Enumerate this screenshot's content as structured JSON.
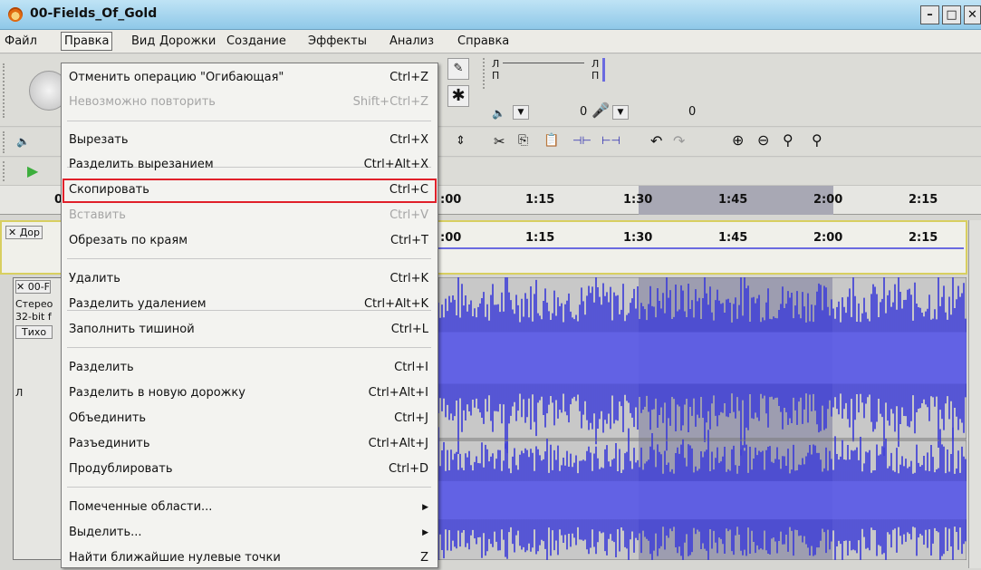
{
  "window": {
    "title": "00-Fields_Of_Gold",
    "minimize": "–",
    "maximize": "□",
    "close": "✕"
  },
  "menubar": {
    "items": [
      "Файл",
      "Правка",
      "Вид",
      "Дорожки",
      "Создание",
      "Эффекты",
      "Анализ",
      "Справка"
    ]
  },
  "ruler": {
    "ticks": [
      ":00",
      "1:15",
      "1:30",
      "1:45",
      "2:00",
      "2:15"
    ],
    "left_tick": "0"
  },
  "timeline": {
    "ticks": [
      ":00",
      "1:15",
      "1:30",
      "1:45",
      "2:00",
      "2:15"
    ]
  },
  "meters": {
    "l1": "Л",
    "r1": "П",
    "l2": "Л",
    "r2": "П",
    "val1": "0",
    "val2": "0"
  },
  "left_panel": {
    "track1": "✕ Дор",
    "track2": "✕ 00-F",
    "stereo": "Стерео",
    "bits": "32-bit f",
    "mute": "Тихо",
    "pan": "Л"
  },
  "edit_menu": {
    "items": [
      {
        "label": "Отменить операцию \"Огибающая\"",
        "shortcut": "Ctrl+Z",
        "enabled": true
      },
      {
        "label": "Невозможно повторить",
        "shortcut": "Shift+Ctrl+Z",
        "enabled": false
      },
      {
        "label": "Вырезать",
        "shortcut": "Ctrl+X",
        "enabled": true
      },
      {
        "label": "Разделить вырезанием",
        "shortcut": "Ctrl+Alt+X",
        "enabled": true
      },
      {
        "label": "Скопировать",
        "shortcut": "Ctrl+C",
        "enabled": true
      },
      {
        "label": "Вставить",
        "shortcut": "Ctrl+V",
        "enabled": false
      },
      {
        "label": "Обрезать по краям",
        "shortcut": "Ctrl+T",
        "enabled": true
      },
      {
        "label": "Удалить",
        "shortcut": "Ctrl+K",
        "enabled": true
      },
      {
        "label": "Разделить удалением",
        "shortcut": "Ctrl+Alt+K",
        "enabled": true
      },
      {
        "label": "Заполнить тишиной",
        "shortcut": "Ctrl+L",
        "enabled": true
      },
      {
        "label": "Разделить",
        "shortcut": "Ctrl+I",
        "enabled": true
      },
      {
        "label": "Разделить в новую дорожку",
        "shortcut": "Ctrl+Alt+I",
        "enabled": true
      },
      {
        "label": "Объединить",
        "shortcut": "Ctrl+J",
        "enabled": true
      },
      {
        "label": "Разъединить",
        "shortcut": "Ctrl+Alt+J",
        "enabled": true
      },
      {
        "label": "Продублировать",
        "shortcut": "Ctrl+D",
        "enabled": true
      },
      {
        "label": "Помеченные области...",
        "shortcut": "",
        "enabled": true,
        "submenu": true
      },
      {
        "label": "Выделить...",
        "shortcut": "",
        "enabled": true,
        "submenu": true
      },
      {
        "label": "Найти ближайшие нулевые точки",
        "shortcut": "Z",
        "enabled": true
      }
    ],
    "highlighted": "Скопировать",
    "highlight_color": "#e0202a"
  },
  "colors": {
    "waveform": "#3a3ad8",
    "selection": "#9d9db0",
    "title_bar": "#8fc8e8"
  }
}
